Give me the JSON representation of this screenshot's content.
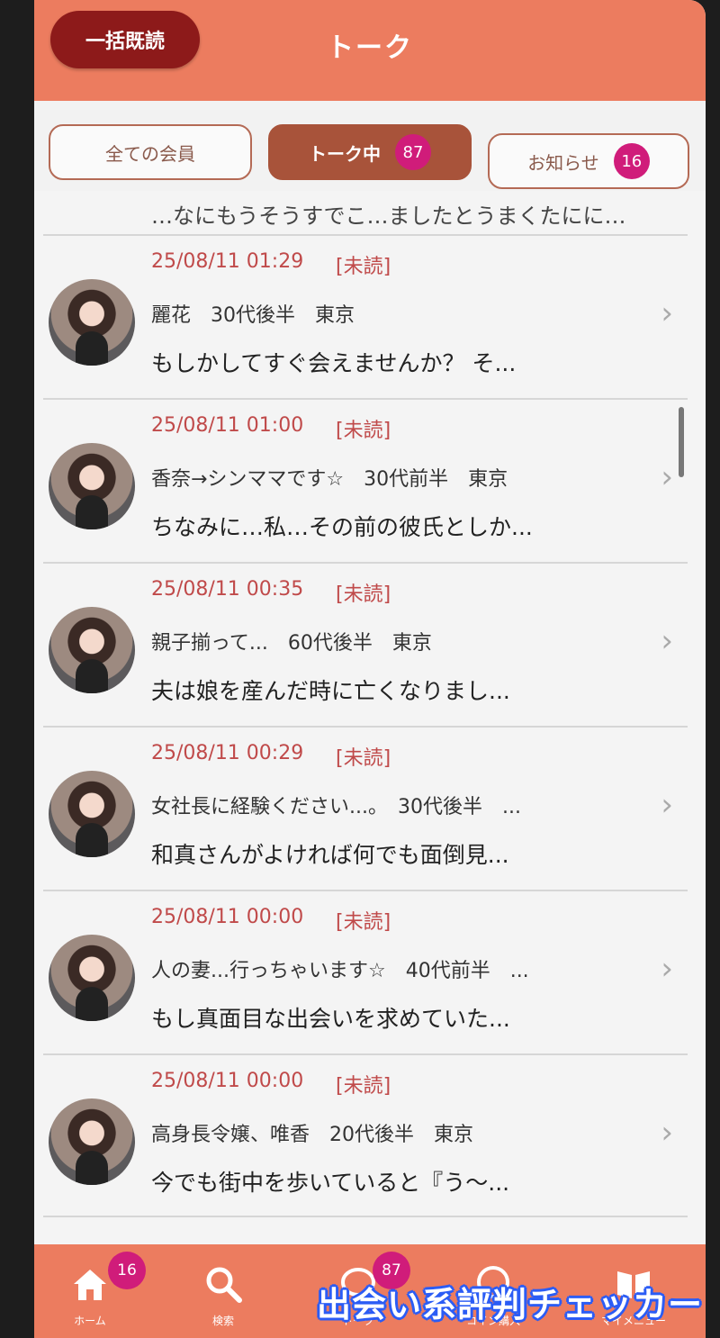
{
  "header": {
    "mark_all_read_label": "一括既読",
    "title": "トーク"
  },
  "tabs": [
    {
      "label": "全ての会員",
      "badge": null
    },
    {
      "label": "トーク中",
      "badge": "87"
    },
    {
      "label": "お知らせ",
      "badge": "16"
    }
  ],
  "list": {
    "prev_snippet": "…なにもうそうすでこ…ましたとうまくたにに…",
    "items": [
      {
        "time": "25/08/11 01:29",
        "status": "[未読]",
        "profile": "麗花　30代後半　東京",
        "message": "もしかしてすぐ会えませんか？ そ..."
      },
      {
        "time": "25/08/11 01:00",
        "status": "[未読]",
        "profile": "香奈→シンママです☆　30代前半　東京",
        "message": "ちなみに…私…その前の彼氏としか..."
      },
      {
        "time": "25/08/11 00:35",
        "status": "[未読]",
        "profile": "親子揃って...　60代後半　東京",
        "message": "夫は娘を産んだ時に亡くなりまし..."
      },
      {
        "time": "25/08/11 00:29",
        "status": "[未読]",
        "profile": "女社長に経験ください...。　30代後半　...",
        "message": "和真さんがよければ何でも面倒見..."
      },
      {
        "time": "25/08/11 00:00",
        "status": "[未読]",
        "profile": "人の妻...行っちゃいます☆　40代前半　...",
        "message": "もし真面目な出会いを求めていた..."
      },
      {
        "time": "25/08/11 00:00",
        "status": "[未読]",
        "profile": "高身長令嬢、唯香　20代後半　東京",
        "message": "今でも街中を歩いていると『う〜..."
      }
    ]
  },
  "bottom_nav": [
    {
      "label": "ホーム",
      "icon": "home-icon",
      "badge": "16"
    },
    {
      "label": "検索",
      "icon": "search-icon",
      "badge": null
    },
    {
      "label": "トーク",
      "icon": "chat-icon",
      "badge": "87"
    },
    {
      "label": "コイン購入",
      "icon": "coin-icon",
      "badge": null
    },
    {
      "label": "マイメニュー",
      "icon": "book-icon",
      "badge": null
    }
  ],
  "watermark": "出会い系評判チェッカー",
  "colors": {
    "brand": "#ec7c5f",
    "active_tab": "#a8533a",
    "badge": "#d01c7a",
    "unread": "#c04a4a"
  }
}
